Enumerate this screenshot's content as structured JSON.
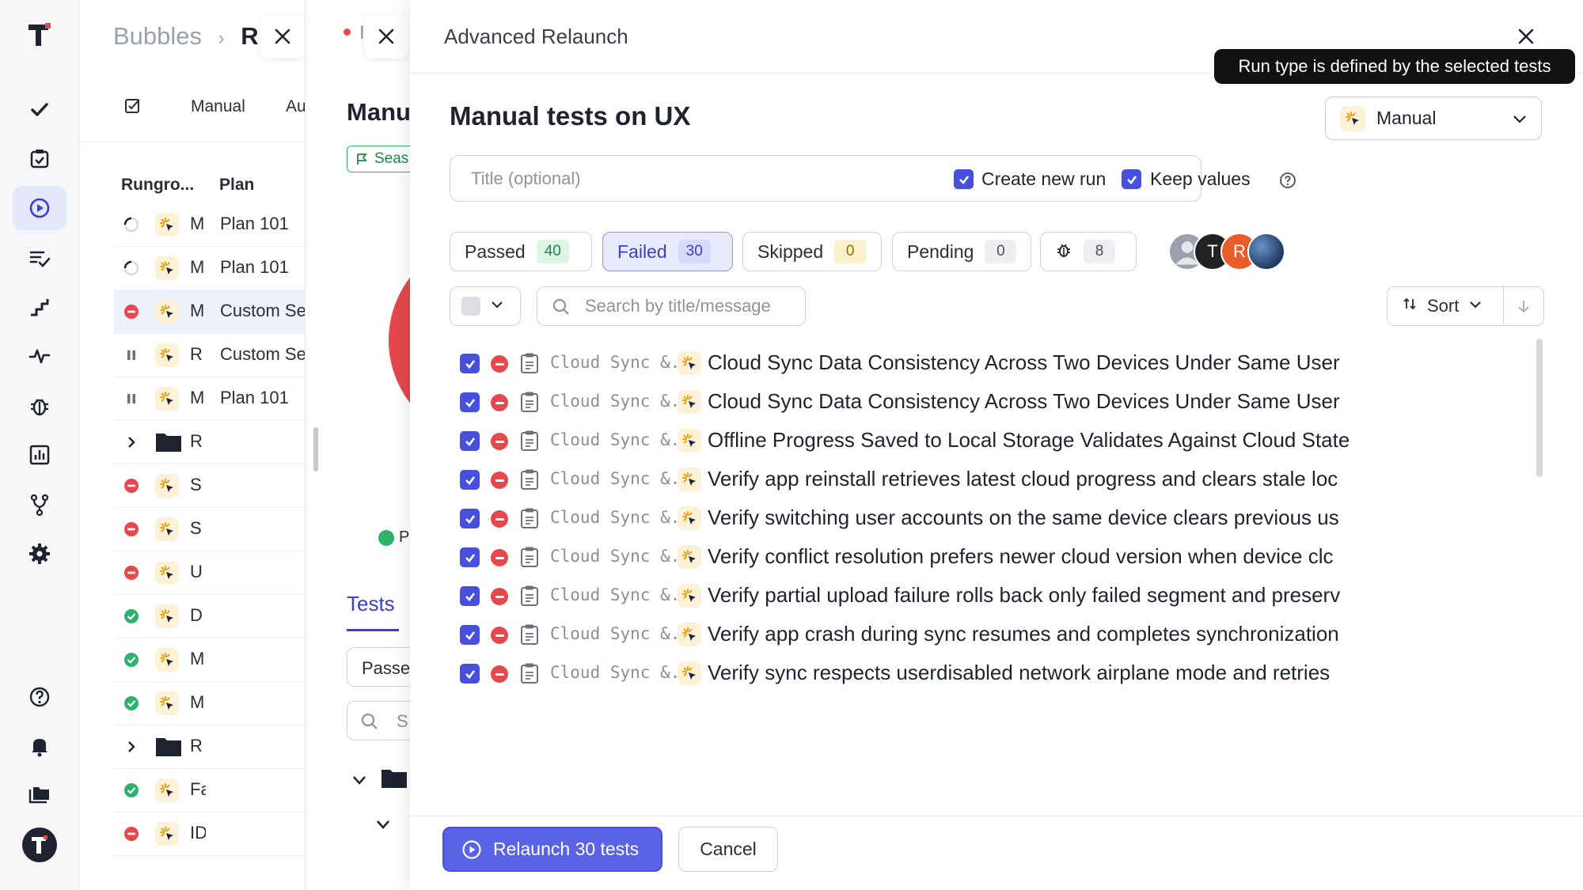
{
  "sidebar": {
    "items": [
      "check-icon",
      "clipboard-check-icon",
      "play-circle-icon",
      "list-check-icon",
      "steps-icon",
      "pulse-icon",
      "bug-icon",
      "chart-icon",
      "branch-icon",
      "gear-icon",
      "help-icon",
      "bell-icon",
      "folders-icon",
      "avatar"
    ]
  },
  "runs_panel": {
    "breadcrumb": {
      "project": "Bubbles",
      "separator": "›",
      "current": "R"
    },
    "tabs": [
      "Manual",
      "Au"
    ],
    "columns": {
      "rungroup": "Rungro...",
      "plan": "Plan"
    },
    "rows": [
      {
        "status": "running",
        "label": "M",
        "plan": "Plan 101"
      },
      {
        "status": "running",
        "label": "M",
        "plan": "Plan 101"
      },
      {
        "status": "failed",
        "label": "M",
        "plan": "Custom Se"
      },
      {
        "status": "paused",
        "label": "R",
        "plan": "Custom Se"
      },
      {
        "status": "paused",
        "label": "M",
        "plan": "Plan 101"
      },
      {
        "status": "folder",
        "label": "R",
        "plan": ""
      },
      {
        "status": "failed",
        "label": "S",
        "plan": ""
      },
      {
        "status": "failed",
        "label": "S",
        "plan": ""
      },
      {
        "status": "failed",
        "label": "U",
        "plan": ""
      },
      {
        "status": "passed",
        "label": "D",
        "plan": ""
      },
      {
        "status": "passed",
        "label": "M",
        "plan": ""
      },
      {
        "status": "passed",
        "label": "M",
        "plan": ""
      },
      {
        "status": "folder",
        "label": "R",
        "plan": ""
      },
      {
        "status": "passed",
        "label": "Fa",
        "plan": ""
      },
      {
        "status": "failed",
        "label": "ID",
        "plan": ""
      }
    ]
  },
  "detail_panel": {
    "crumb": "I",
    "title": "Manu",
    "badge": "Seas",
    "legend": "Pa",
    "tab": "Tests",
    "filter": "Passe",
    "search": "S"
  },
  "modal": {
    "header_title": "Advanced Relaunch",
    "tooltip": "Run type is defined by the selected tests",
    "title": "Manual tests on UX",
    "run_type": "Manual",
    "title_placeholder": "Title (optional)",
    "create_new_run": "Create new run",
    "keep_values": "Keep values",
    "filters": [
      {
        "label": "Passed",
        "count": "40",
        "badge_bg": "#dcf5e4",
        "badge_fg": "#1f8a47",
        "selected": false
      },
      {
        "label": "Failed",
        "count": "30",
        "badge_bg": "#d5dafa",
        "badge_fg": "#3941c8",
        "selected": true
      },
      {
        "label": "Skipped",
        "count": "0",
        "badge_bg": "#fdf1cc",
        "badge_fg": "#9a6b00",
        "selected": false
      },
      {
        "label": "Pending",
        "count": "0",
        "badge_bg": "#eeeff2",
        "badge_fg": "#4a4f5a",
        "selected": false
      },
      {
        "label": "",
        "icon": "bug-icon",
        "count": "8",
        "badge_bg": "#eeeff2",
        "badge_fg": "#4a4f5a",
        "selected": false
      }
    ],
    "avatars": [
      {
        "initial": "",
        "color": "#9aa0ad"
      },
      {
        "initial": "T",
        "color": "#222222"
      },
      {
        "initial": "R",
        "color": "#e85d2a"
      },
      {
        "initial": "",
        "color": "#2c4a78"
      }
    ],
    "search_placeholder": "Search by title/message",
    "sort_label": "Sort",
    "tests": [
      {
        "suite": "Cloud Sync &...",
        "name": "Cloud Sync Data Consistency Across Two Devices Under Same User"
      },
      {
        "suite": "Cloud Sync &...",
        "name": "Cloud Sync Data Consistency Across Two Devices Under Same User"
      },
      {
        "suite": "Cloud Sync &...",
        "name": "Offline Progress Saved to Local Storage Validates Against Cloud State"
      },
      {
        "suite": "Cloud Sync &...",
        "name": "Verify app reinstall retrieves latest cloud progress and clears stale loc"
      },
      {
        "suite": "Cloud Sync &...",
        "name": "Verify switching user accounts on the same device clears previous us"
      },
      {
        "suite": "Cloud Sync &...",
        "name": "Verify conflict resolution prefers newer cloud version when device clc"
      },
      {
        "suite": "Cloud Sync &...",
        "name": "Verify partial upload failure rolls back only failed segment and preserv"
      },
      {
        "suite": "Cloud Sync &...",
        "name": "Verify app crash during sync resumes and completes synchronization"
      },
      {
        "suite": "Cloud Sync &...",
        "name": "Verify sync respects userdisabled network airplane mode and retries"
      }
    ],
    "relaunch_label": "Relaunch 30 tests",
    "cancel_label": "Cancel"
  },
  "colors": {
    "accent": "#4650dd",
    "failed": "#e5484d",
    "passed": "#2fb36a"
  }
}
